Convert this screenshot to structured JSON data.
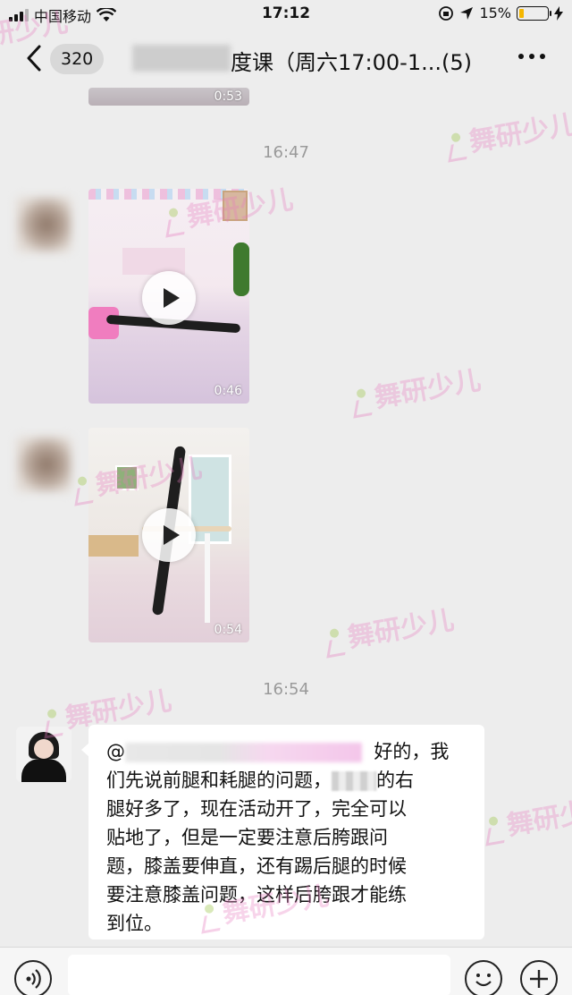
{
  "status_bar": {
    "carrier": "中国移动",
    "time": "17:12",
    "battery_text": "15%",
    "battery_level": 0.15
  },
  "nav": {
    "unread_badge": "320",
    "title": "度课（周六17:00-1...",
    "member_count": "(5)"
  },
  "messages": [
    {
      "type": "video",
      "duration": "0:53"
    },
    {
      "type": "timestamp",
      "text": "16:47"
    },
    {
      "type": "video",
      "duration": "0:46"
    },
    {
      "type": "video",
      "duration": "0:54"
    },
    {
      "type": "timestamp",
      "text": "16:54"
    },
    {
      "type": "text",
      "mention_prefix": "@",
      "lines": [
        "好的，我",
        "们先说前腿和耗腿的问题，",
        "的右",
        "腿好多了，现在活动开了，完全可以",
        "贴地了，但是一定要注意后胯跟问",
        "题，膝盖要伸直，还有踢后腿的时候",
        "要注意膝盖问题，这样后胯跟才能练",
        "到位。"
      ]
    }
  ],
  "watermark": "舞研少儿",
  "icons": {
    "back": "chevron-left-icon",
    "more": "ellipsis-icon",
    "voice": "voice-icon",
    "emoji": "emoji-icon",
    "plus": "plus-icon",
    "play": "play-icon"
  },
  "colors": {
    "background": "#ededed",
    "bubble": "#ffffff",
    "battery": "#f5b700",
    "watermark": "#e678be"
  }
}
